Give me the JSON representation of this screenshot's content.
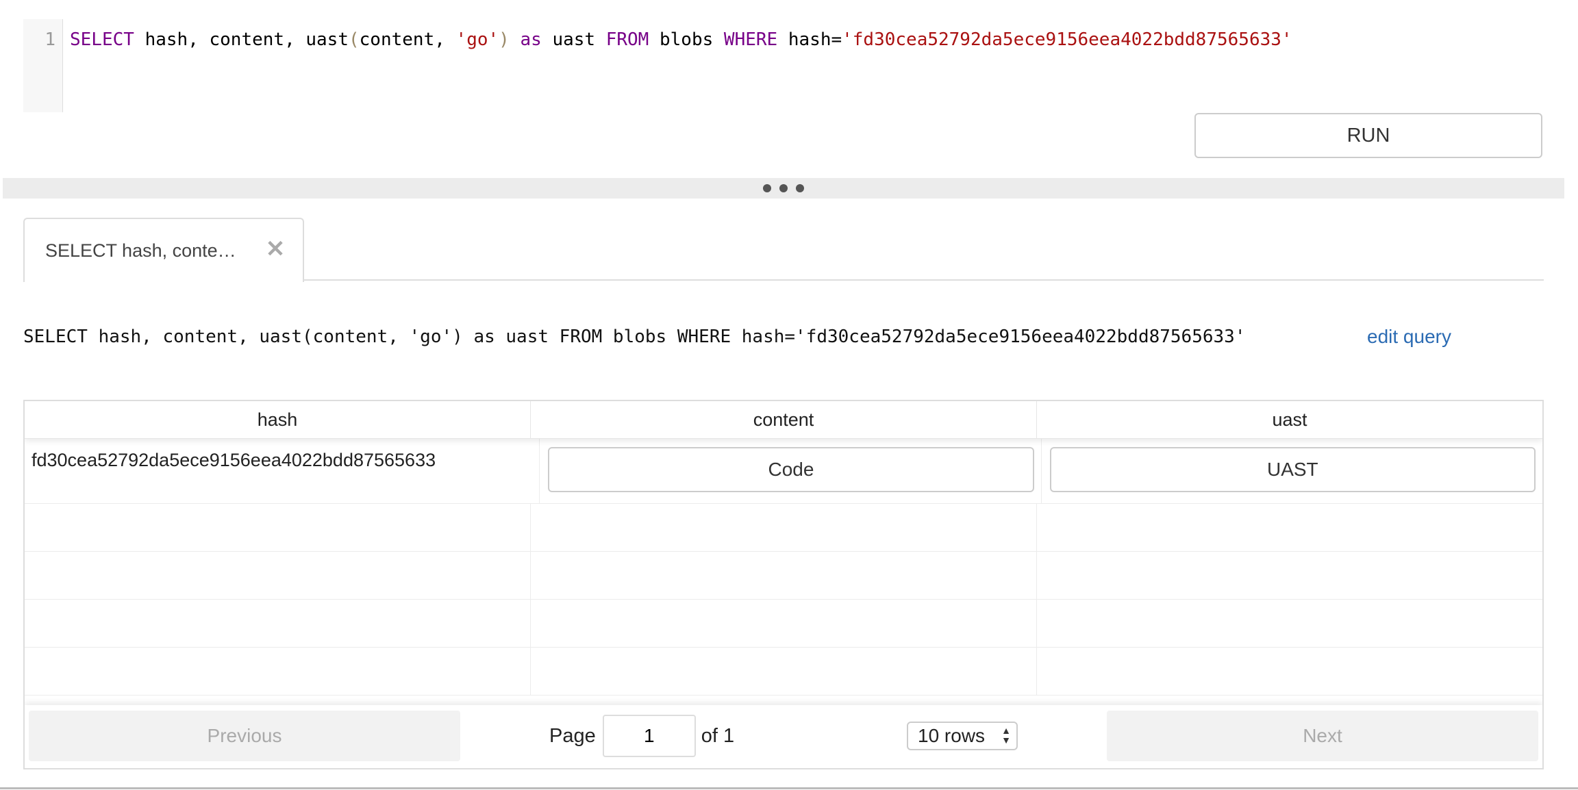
{
  "editor": {
    "line_number": "1",
    "tokens": [
      {
        "text": "SELECT",
        "cls": "tk-kw"
      },
      {
        "text": " hash, content, uast",
        "cls": "tk-plain"
      },
      {
        "text": "(",
        "cls": "tk-paren"
      },
      {
        "text": "content, ",
        "cls": "tk-plain"
      },
      {
        "text": "'go'",
        "cls": "tk-str"
      },
      {
        "text": ")",
        "cls": "tk-paren"
      },
      {
        "text": " ",
        "cls": "tk-plain"
      },
      {
        "text": "as",
        "cls": "tk-kw"
      },
      {
        "text": " uast ",
        "cls": "tk-plain"
      },
      {
        "text": "FROM",
        "cls": "tk-kw"
      },
      {
        "text": " blobs ",
        "cls": "tk-plain"
      },
      {
        "text": "WHERE",
        "cls": "tk-kw"
      },
      {
        "text": " hash=",
        "cls": "tk-plain"
      },
      {
        "text": "'fd30cea52792da5ece9156eea4022bdd87565633'",
        "cls": "tk-str"
      }
    ]
  },
  "run_label": "RUN",
  "tab": {
    "label": "SELECT hash, conte…",
    "close": "✕"
  },
  "query": {
    "text": "SELECT hash, content, uast(content, 'go') as uast FROM blobs WHERE hash='fd30cea52792da5ece9156eea4022bdd87565633'",
    "edit_label": "edit query"
  },
  "table": {
    "columns": [
      "hash",
      "content",
      "uast"
    ],
    "rows": [
      {
        "hash": "fd30cea52792da5ece9156eea4022bdd87565633",
        "content_btn": "Code",
        "uast_btn": "UAST"
      }
    ],
    "empty_rows": 4
  },
  "pagination": {
    "previous": "Previous",
    "page_label": "Page",
    "page_value": "1",
    "of_label": "of 1",
    "rows_select": "10 rows",
    "next": "Next"
  }
}
